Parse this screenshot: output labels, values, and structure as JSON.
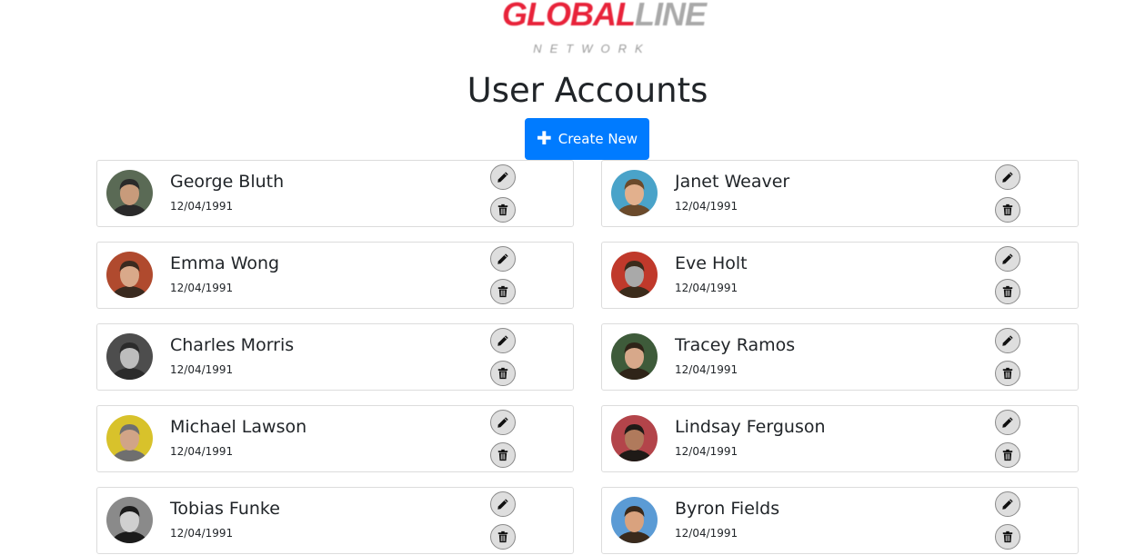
{
  "logo": {
    "text_primary": "GLOBAL",
    "text_secondary": "LINE",
    "subtext": "NETWORK"
  },
  "header": {
    "title": "User Accounts"
  },
  "actions": {
    "create_label": "Create New",
    "create_icon": "plus-icon"
  },
  "colors": {
    "primary": "#007bff",
    "logo_red": "#e8233a",
    "logo_grey": "#a9a9a9"
  },
  "users": [
    {
      "name": "George Bluth",
      "date": "12/04/1991",
      "avatar_bg": "#5a6a55",
      "skin": "#c89b7b",
      "hair": "#2a2a2a"
    },
    {
      "name": "Janet Weaver",
      "date": "12/04/1991",
      "avatar_bg": "#4aa3c9",
      "skin": "#e2b08d",
      "hair": "#6b4a2b"
    },
    {
      "name": "Emma Wong",
      "date": "12/04/1991",
      "avatar_bg": "#b04a2e",
      "skin": "#d9a98a",
      "hair": "#3a2a1f"
    },
    {
      "name": "Eve Holt",
      "date": "12/04/1991",
      "avatar_bg": "#c0392b",
      "skin": "#a9a9a9",
      "hair": "#3b2b1b"
    },
    {
      "name": "Charles Morris",
      "date": "12/04/1991",
      "avatar_bg": "#4d4d4d",
      "skin": "#bdbdbd",
      "hair": "#2b2b2b"
    },
    {
      "name": "Tracey Ramos",
      "date": "12/04/1991",
      "avatar_bg": "#3e5b3a",
      "skin": "#d7a88a",
      "hair": "#2f2418"
    },
    {
      "name": "Michael Lawson",
      "date": "12/04/1991",
      "avatar_bg": "#d8c22b",
      "skin": "#d1a487",
      "hair": "#6f6f6f"
    },
    {
      "name": "Lindsay Ferguson",
      "date": "12/04/1991",
      "avatar_bg": "#b3444a",
      "skin": "#b07a5c",
      "hair": "#1f1a17"
    },
    {
      "name": "Tobias Funke",
      "date": "12/04/1991",
      "avatar_bg": "#8a8a8a",
      "skin": "#d0d0d0",
      "hair": "#1b1b1b"
    },
    {
      "name": "Byron Fields",
      "date": "12/04/1991",
      "avatar_bg": "#5b9bd5",
      "skin": "#d9a27e",
      "hair": "#3a2a1c"
    }
  ],
  "row_actions": {
    "edit_icon": "pencil-icon",
    "delete_icon": "trash-icon"
  }
}
